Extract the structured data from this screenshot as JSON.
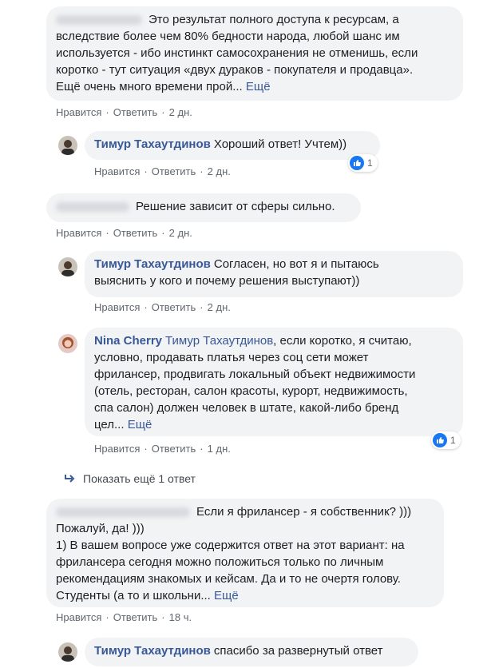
{
  "comments": [
    {
      "text_lines": [
        "Это результат полного доступа к ресурсам, а",
        "вследствие более чем 80% бедности народа, любой шанс им",
        "используется - ибо инстинкт самосохранения не отменишь, если",
        "коротко - тут ситуация «двух дураков - покупателя и продавца».",
        "Ещё очень много времени прой..."
      ],
      "more": "Ещё",
      "like": "Нравится",
      "reply": "Ответить",
      "time": "2 дн."
    },
    {
      "author": "Тимур Тахаутдинов",
      "text": "Хороший ответ! Учтем))",
      "like": "Нравится",
      "reply": "Ответить",
      "time": "2 дн.",
      "reactions": "1"
    },
    {
      "text": "Решение зависит от сферы сильно.",
      "like": "Нравится",
      "reply": "Ответить",
      "time": "2 дн."
    },
    {
      "author": "Тимур Тахаутдинов",
      "text_lines": [
        "Согласен, но вот я и пытаюсь",
        "выяснить у кого и почему решения выступают))"
      ],
      "like": "Нравится",
      "reply": "Ответить",
      "time": "2 дн."
    },
    {
      "author": "Nina Cherry",
      "mention": "Тимур Тахаутдинов",
      "text_lines": [
        ", если коротко, я считаю,",
        "условно, продавать платья через соц сети может",
        "фрилансер, продвигать локальный объект недвижимости",
        "(отель, ресторан, салон красоты, курорт, недвижимость,",
        "спа салон) должен человек в штате, какой-либо бренд",
        "цел..."
      ],
      "more": "Ещё",
      "like": "Нравится",
      "reply": "Ответить",
      "time": "1 дн.",
      "reactions": "1"
    },
    {
      "text_lines": [
        "Если я фрилансер - я собственник? )))",
        "Пожалуй, да! )))",
        "1) В вашем вопросе уже содержится ответ на этот вариант: на",
        "фрилансера сегодня можно положиться только по личным",
        "рекомендациям знакомых и кейсам. Да и то не очертя голову.",
        "Студенты (а то и школьни..."
      ],
      "more": "Ещё",
      "like": "Нравится",
      "reply": "Ответить",
      "time": "18 ч."
    },
    {
      "author": "Тимур Тахаутдинов",
      "text": "спасибо за развернутый ответ"
    }
  ],
  "show_more_replies": "Показать ещё 1 ответ",
  "colors": {
    "link": "#385898",
    "bubble": "#f2f3f5",
    "meta": "#606770",
    "like": "#1877f2"
  }
}
